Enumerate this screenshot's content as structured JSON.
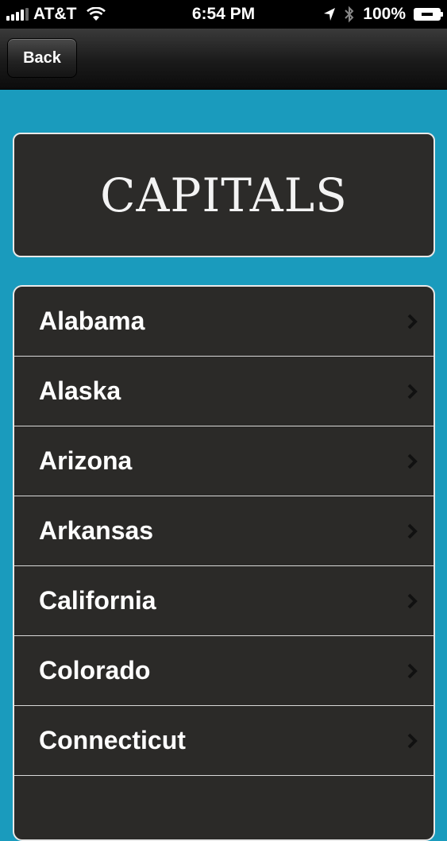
{
  "status_bar": {
    "carrier": "AT&T",
    "time": "6:54 PM",
    "battery": "100%"
  },
  "nav": {
    "back_label": "Back"
  },
  "header": {
    "title": "CAPITALS"
  },
  "states": {
    "items": [
      {
        "label": "Alabama"
      },
      {
        "label": "Alaska"
      },
      {
        "label": "Arizona"
      },
      {
        "label": "Arkansas"
      },
      {
        "label": "California"
      },
      {
        "label": "Colorado"
      },
      {
        "label": "Connecticut"
      },
      {
        "label": ""
      }
    ]
  },
  "icons": {
    "signal": "signal-bars-icon",
    "wifi": "wifi-icon",
    "location": "location-arrow-icon",
    "bluetooth": "bluetooth-icon",
    "battery": "battery-icon",
    "disclosure": "chevron-right-icon"
  },
  "colors": {
    "background": "#1a9bbd",
    "panel": "#2b2a28",
    "border": "#e8e8e8"
  }
}
